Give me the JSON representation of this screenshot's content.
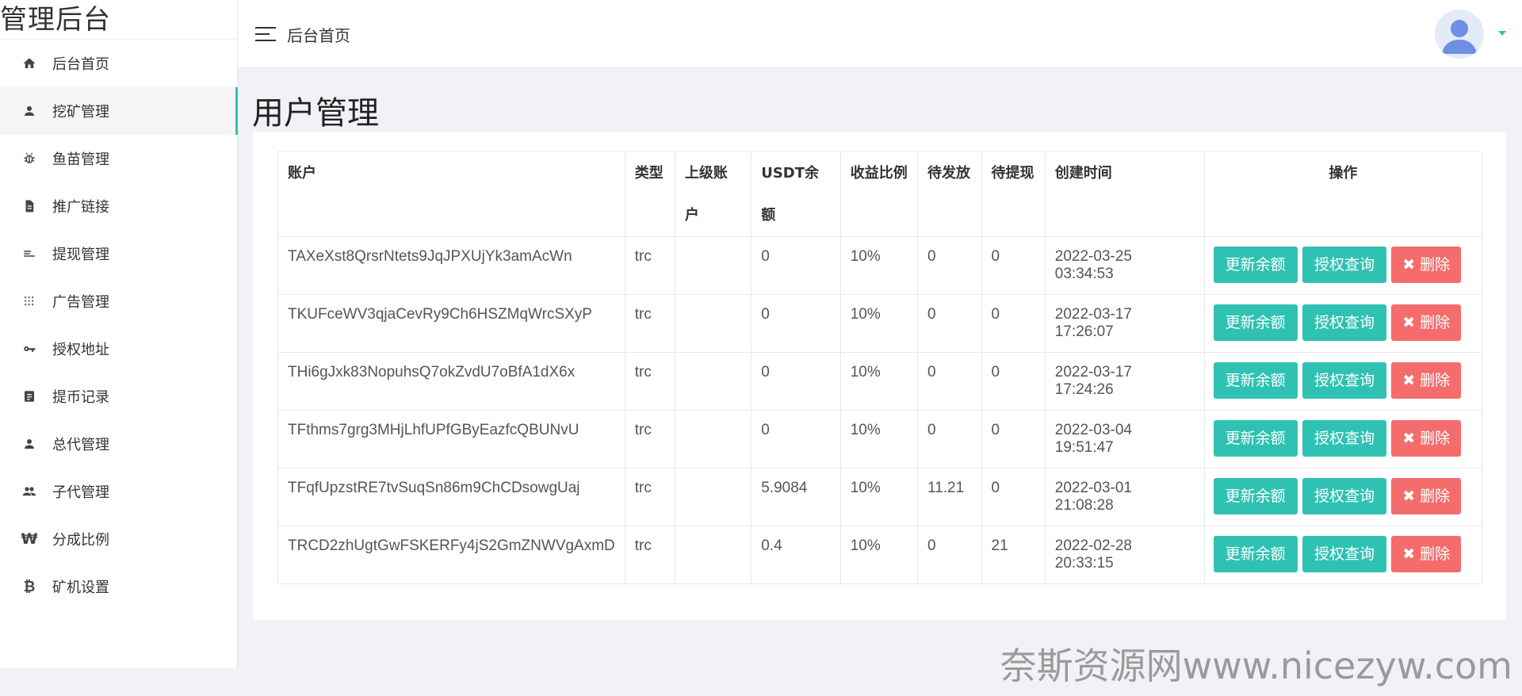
{
  "app": {
    "brand": "管理后台"
  },
  "sidebar": {
    "items": [
      {
        "label": "后台首页",
        "icon": "home-icon",
        "active": false
      },
      {
        "label": "挖矿管理",
        "icon": "user-icon",
        "active": true
      },
      {
        "label": "鱼苗管理",
        "icon": "bug-icon",
        "active": false
      },
      {
        "label": "推广链接",
        "icon": "file-icon",
        "active": false
      },
      {
        "label": "提现管理",
        "icon": "list-icon",
        "active": false
      },
      {
        "label": "广告管理",
        "icon": "grid-icon",
        "active": false
      },
      {
        "label": "授权地址",
        "icon": "key-icon",
        "active": false
      },
      {
        "label": "提币记录",
        "icon": "document-icon",
        "active": false
      },
      {
        "label": "总代管理",
        "icon": "user-icon",
        "active": false
      },
      {
        "label": "子代管理",
        "icon": "users-icon",
        "active": false
      },
      {
        "label": "分成比例",
        "icon": "won-icon",
        "active": false
      },
      {
        "label": "矿机设置",
        "icon": "bitcoin-icon",
        "active": false
      }
    ]
  },
  "header": {
    "title": "后台首页"
  },
  "page": {
    "title": "用户管理"
  },
  "table": {
    "columns": [
      "账户",
      "类型",
      "上级账户",
      "USDT余额",
      "收益比例",
      "待发放",
      "待提现",
      "创建时间",
      "操作"
    ],
    "rows": [
      {
        "account": "TAXeXst8QrsrNtets9JqJPXUjYk3amAcWn",
        "type": "trc",
        "parent": "",
        "usdt": "0",
        "ratio": "10%",
        "pending": "0",
        "withdraw": "0",
        "created": "2022-03-25 03:34:53"
      },
      {
        "account": "TKUFceWV3qjaCevRy9Ch6HSZMqWrcSXyP",
        "type": "trc",
        "parent": "",
        "usdt": "0",
        "ratio": "10%",
        "pending": "0",
        "withdraw": "0",
        "created": "2022-03-17 17:26:07"
      },
      {
        "account": "THi6gJxk83NopuhsQ7okZvdU7oBfA1dX6x",
        "type": "trc",
        "parent": "",
        "usdt": "0",
        "ratio": "10%",
        "pending": "0",
        "withdraw": "0",
        "created": "2022-03-17 17:24:26"
      },
      {
        "account": "TFthms7grg3MHjLhfUPfGByEazfcQBUNvU",
        "type": "trc",
        "parent": "",
        "usdt": "0",
        "ratio": "10%",
        "pending": "0",
        "withdraw": "0",
        "created": "2022-03-04 19:51:47"
      },
      {
        "account": "TFqfUpzstRE7tvSuqSn86m9ChCDsowgUaj",
        "type": "trc",
        "parent": "",
        "usdt": "5.9084",
        "ratio": "10%",
        "pending": "11.21",
        "withdraw": "0",
        "created": "2022-03-01 21:08:28"
      },
      {
        "account": "TRCD2zhUgtGwFSKERFy4jS2GmZNWVgAxmD",
        "type": "trc",
        "parent": "",
        "usdt": "0.4",
        "ratio": "10%",
        "pending": "0",
        "withdraw": "21",
        "created": "2022-02-28 20:33:15"
      }
    ],
    "actions": {
      "update_balance": "更新余额",
      "auth_query": "授权查询",
      "delete": "删除"
    }
  },
  "watermark": "奈斯资源网www.nicezyw.com",
  "colors": {
    "accent": "#2fc2b2",
    "danger": "#f56c6c"
  }
}
